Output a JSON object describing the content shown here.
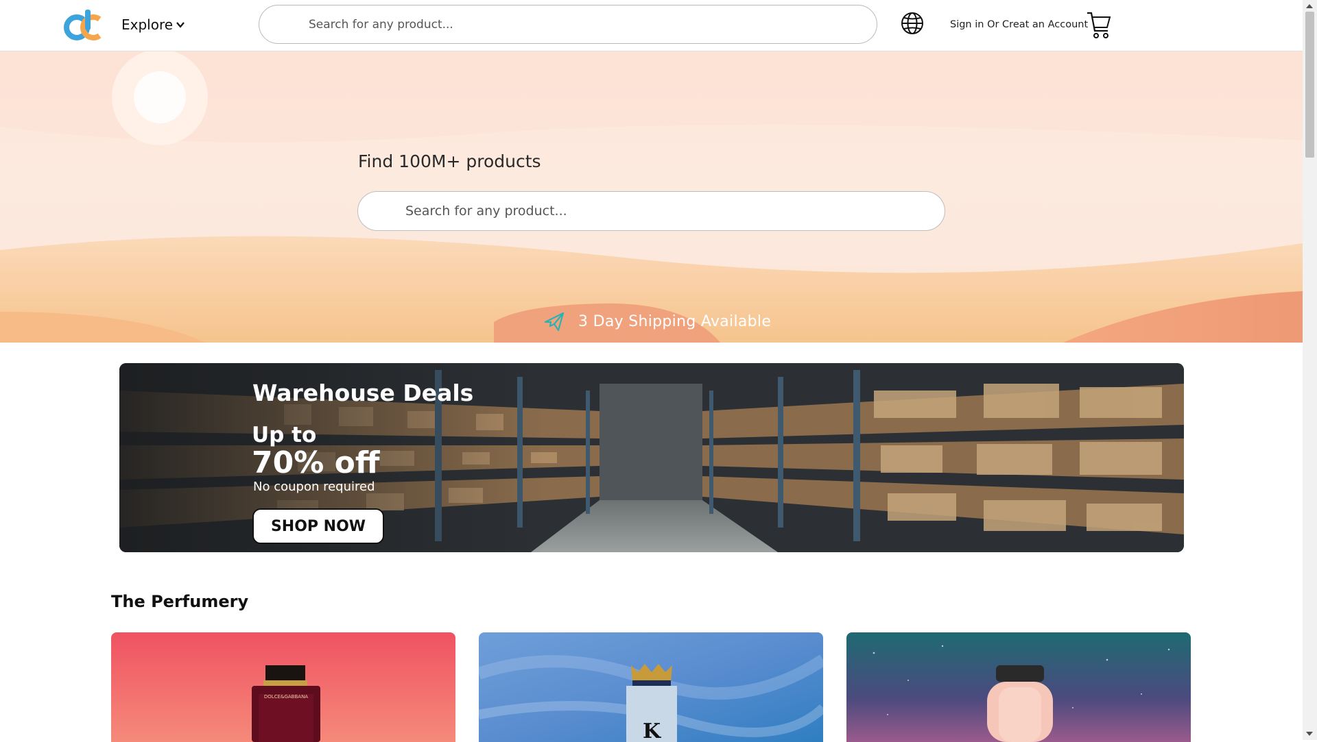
{
  "header": {
    "logo_alt": "dc",
    "explore_label": "Explore",
    "search_placeholder": "Search for any product...",
    "signin_label": "Sign in Or Creat an Account",
    "icons": [
      "chevron-down-icon",
      "globe-icon",
      "cart-icon"
    ]
  },
  "hero": {
    "title": "Find 100M+ products",
    "search_placeholder": "Search for any product...",
    "shipping_text": "3 Day Shipping Available",
    "icons": [
      "airplane-icon"
    ]
  },
  "banner": {
    "heading": "Warehouse Deals",
    "up_to": "Up to",
    "discount": "70% off",
    "note": "No coupon required",
    "cta": "SHOP NOW"
  },
  "perfumery": {
    "title": "The Perfumery",
    "cards": [
      {
        "name": "perfume-card-red",
        "bottle_label": "DOLCE&GABBANA",
        "color": "#ef5a66"
      },
      {
        "name": "perfume-card-blue",
        "bottle_label": "K",
        "color": "#5e94d6"
      },
      {
        "name": "perfume-card-galaxy",
        "bottle_label": "",
        "color": "#2f5a6b"
      }
    ]
  },
  "colors": {
    "accent_orange": "#f5a54a",
    "accent_blue": "#3da3dc",
    "hero_bg": "#fde6da"
  }
}
